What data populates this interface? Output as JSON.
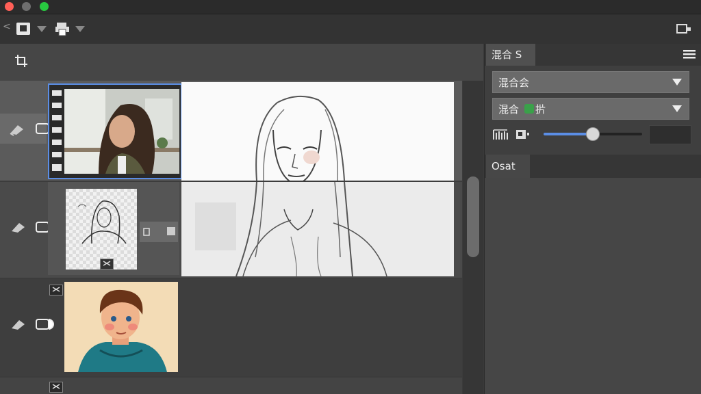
{
  "colors": {
    "close": "#ff5f57",
    "minimize": "#febc2e",
    "maximize": "#28c840",
    "accent": "#5b8ee6"
  },
  "toolbar": {
    "back_glyph": "<"
  },
  "right_panel": {
    "tab1_label": "混合 S",
    "dropdown1_value": "混合会",
    "dropdown2_prefix": "混合",
    "dropdown2_suffix": "扸",
    "tab2_label": "Osat",
    "opacity_fraction": 0.5
  },
  "layers": [
    {
      "name": "layer-photo",
      "selected": true
    },
    {
      "name": "layer-sketch",
      "selected": false
    },
    {
      "name": "layer-cartoon",
      "selected": false
    }
  ],
  "icons": [
    "crop-icon",
    "gear-icon",
    "eraser-icon",
    "link-icon",
    "menu-icon",
    "layout-icon"
  ]
}
